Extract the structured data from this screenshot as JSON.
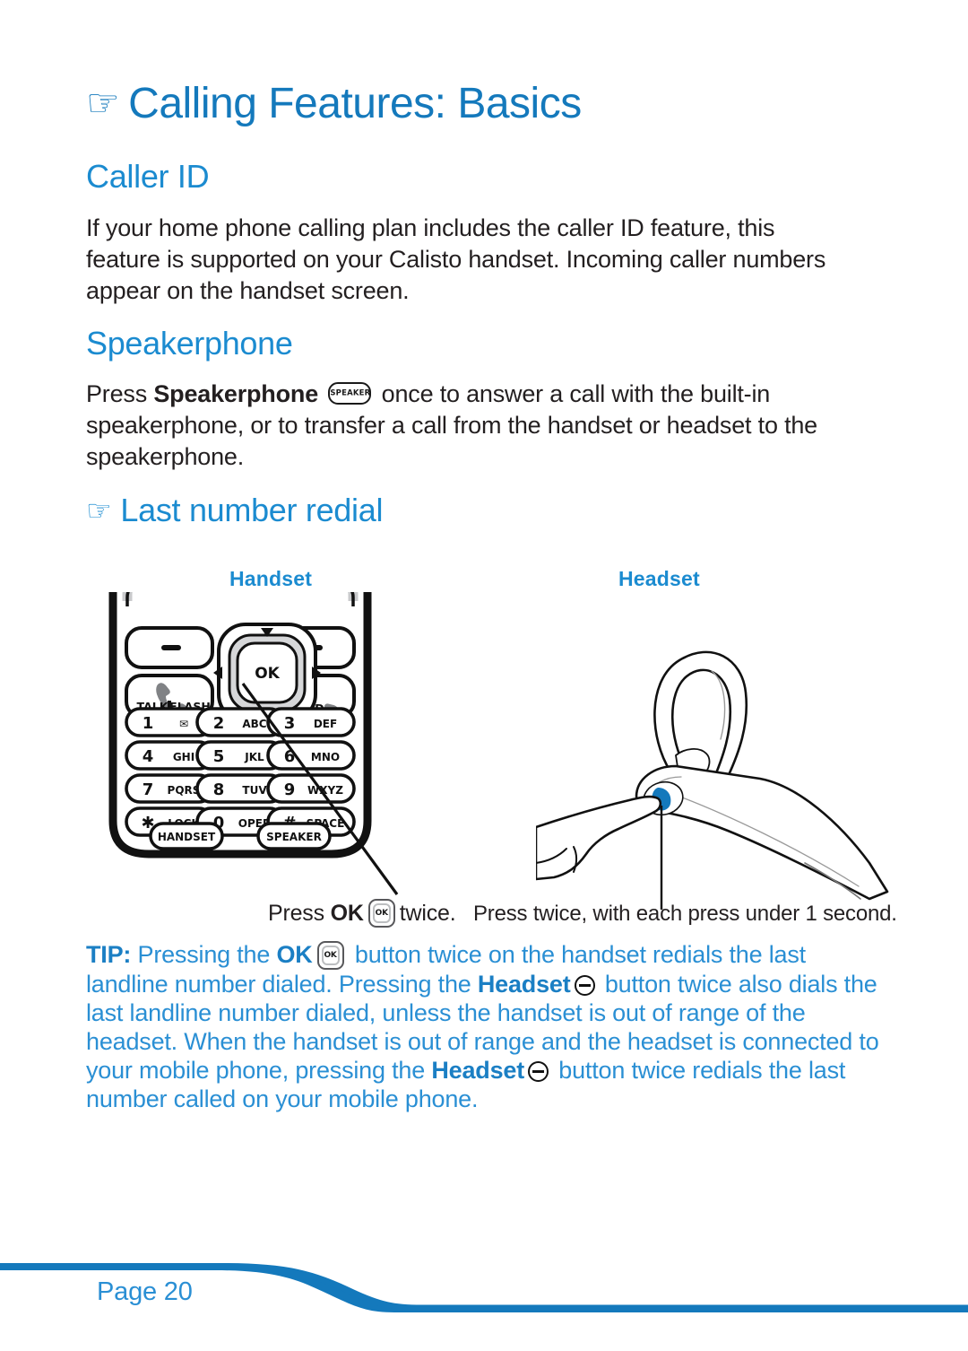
{
  "page": {
    "title": "Calling Features: Basics",
    "title_icon": "pointing-hand-icon",
    "page_label": "Page 20",
    "accent_color": "#1479bc",
    "accent_light": "#1b8bd0",
    "tip_color": "#2a8fd4",
    "ink_color": "#231f20"
  },
  "sections": {
    "caller_id": {
      "heading": "Caller ID",
      "body": "If your home phone calling plan includes the caller ID feature, this feature is supported on your Calisto handset. Incoming caller numbers appear on the handset screen."
    },
    "speakerphone": {
      "heading": "Speakerphone",
      "body_lead": "Press",
      "body_bold": "Speakerphone",
      "key_icon_label": "SPEAKER",
      "body_rest": "once to answer a call with the built-in speakerphone, or to transfer a call from the handset or headset to the speakerphone."
    },
    "last_number_redial": {
      "heading": "Last number redial",
      "heading_icon": "pointing-hand-icon"
    }
  },
  "figures": {
    "handset": {
      "label": "Handset",
      "caption_lead": "Press",
      "caption_bold": "OK",
      "caption_key": "OK",
      "caption_rest": "twice.",
      "keypad": [
        [
          {
            "digit": "1",
            "letters": "✉"
          },
          {
            "digit": "2",
            "letters": "ABC"
          },
          {
            "digit": "3",
            "letters": "DEF"
          }
        ],
        [
          {
            "digit": "4",
            "letters": "GHI"
          },
          {
            "digit": "5",
            "letters": "JKL"
          },
          {
            "digit": "6",
            "letters": "MNO"
          }
        ],
        [
          {
            "digit": "7",
            "letters": "PQRS"
          },
          {
            "digit": "8",
            "letters": "TUV"
          },
          {
            "digit": "9",
            "letters": "WXYZ"
          }
        ],
        [
          {
            "digit": "✱",
            "letters": "LOCK"
          },
          {
            "digit": "0",
            "letters": "OPER"
          },
          {
            "digit": "#",
            "letters": "SPACE"
          }
        ]
      ],
      "talk_label": "TALK",
      "flash_label": "FLASH",
      "end_label": "END",
      "ok_label": "OK",
      "handset_button": "HANDSET",
      "speaker_button": "SPEAKER"
    },
    "headset": {
      "label": "Headset",
      "caption": "Press twice, with each press under 1 second.",
      "button_color": "#1479bc"
    }
  },
  "tip": {
    "label": "TIP:",
    "t1": " Pressing the ",
    "b1": "OK",
    "t2": " button twice on the handset redials the last landline number dialed. Pressing the ",
    "b2": "Headset",
    "t3": " button twice also dials the last landline number dialed, unless the handset is out of range of the headset. When the handset is out of range and the headset is connected to your mobile phone, pressing the ",
    "b3": "Headset",
    "t4": " button twice redials the last number called on your mobile phone."
  }
}
